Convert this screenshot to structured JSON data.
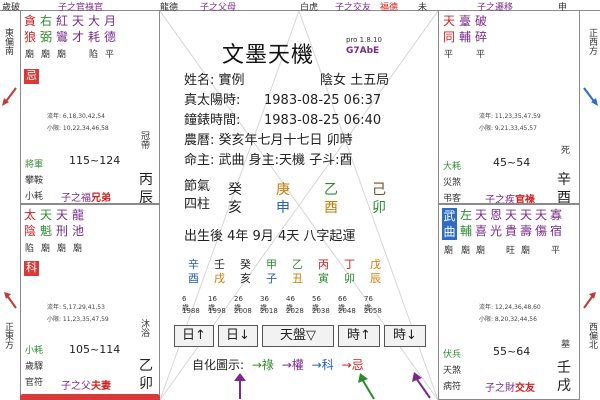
{
  "top_strip": {
    "left_a": "歲破",
    "left_b": "子之官祿官",
    "left_c": "龍德",
    "left_d": "子之父母",
    "left_e": "白虎",
    "left_f": "子之交友",
    "left_g": "福德",
    "left_h": "未",
    "right_a": "子之遷移",
    "right_b": "申"
  },
  "left_top": {
    "stars": [
      "貪",
      "右",
      "紅",
      "天",
      "大",
      "月"
    ],
    "stars2": [
      "狼",
      "弼",
      "鸞",
      "才",
      "耗",
      "德"
    ],
    "levels": [
      "廟",
      "廟",
      "廟",
      "陷",
      "平"
    ],
    "badge": "忌",
    "year_line1": "流年: 6,18,30,42,54",
    "year_line2": "小限: 10,22,34,46,58",
    "status": "冠帶",
    "god1": "將軍",
    "god2": "攀鞍",
    "god3": "小耗",
    "range": "115~124",
    "palace": "子之福",
    "palace_hl": "兄弟",
    "branch1": "丙",
    "branch2": "辰"
  },
  "left_mid": {
    "stars": [
      "太",
      "天",
      "天",
      "龍"
    ],
    "stars2": [
      "陰",
      "魁",
      "刑",
      "池"
    ],
    "levels": [
      "陷",
      "廟",
      "廟",
      "廟"
    ],
    "badge": "科",
    "year_line1": "流年: 5,17,29,41,53",
    "year_line2": "小限: 11,23,35,47,59",
    "status": "沐浴",
    "god1": "小耗",
    "god2": "歲驛",
    "god3": "官符",
    "range": "105~114",
    "palace": "子之父",
    "palace_hl": "夫妻",
    "branch1": "乙",
    "branch2": "卯"
  },
  "right_top": {
    "stars": [
      "天",
      "臺",
      "破"
    ],
    "stars2": [
      "同",
      "輔",
      "碎"
    ],
    "levels": [
      "平",
      "平"
    ],
    "year_line1": "流年: 11,23,35,47,59",
    "year_line2": "小限: 9,21,33,45,57",
    "status": "死",
    "god1": "大耗",
    "god2": "災煞",
    "god3": "弔客",
    "range": "45~54",
    "palace": "子之疾",
    "palace_hl": "官祿",
    "branch1": "辛",
    "branch2": "酉"
  },
  "right_mid": {
    "stars_blue_box": [
      "武",
      "曲"
    ],
    "stars": [
      "左",
      "天",
      "恩",
      "天",
      "天",
      "天",
      "寡"
    ],
    "stars2": [
      "輔",
      "喜",
      "光",
      "貴",
      "壽",
      "傷",
      "宿"
    ],
    "levels": [
      "廟",
      "廟",
      "廟",
      "旺",
      "廟",
      "平"
    ],
    "year_line1": "流年: 12,24,36,48,60",
    "year_line2": "小限: 8,20,32,44,56",
    "status": "墓",
    "god1": "伏兵",
    "god2": "天煞",
    "god3": "病符",
    "range": "55~64",
    "palace": "子之財",
    "palace_hl": "交友",
    "branch1": "壬",
    "branch2": "戌"
  },
  "side_labels": {
    "left_top": "東偏南",
    "left_bottom": "正東方",
    "right_top": "正西方",
    "right_bottom": "西偏北"
  },
  "center": {
    "title": "文墨天機",
    "version": "pro 1.8.10",
    "code": "G7AbE",
    "name_label": "姓名: 實例",
    "gender": "陰女 土五局",
    "solar_label": "真太陽時:",
    "solar_value": "1983-08-25 06:37",
    "clock_label": "鐘錶時間:",
    "clock_value": "1983-08-25 06:40",
    "lunar": "農曆: 癸亥年七月十七日 卯時",
    "master": "命主: 武曲 身主:天機 子斗:酉",
    "pillar_label1": "節氣",
    "pillar_label2": "四柱",
    "pillar_top": [
      "癸",
      "庚",
      "乙",
      "己"
    ],
    "pillar_bottom": [
      "亥",
      "申",
      "酉",
      "卯"
    ],
    "luck_start": "出生後 4年 9月 4天 八字起運",
    "luck_top": [
      "辛",
      "壬",
      "癸",
      "甲",
      "乙",
      "丙",
      "丁",
      "戊"
    ],
    "luck_top2": [
      "酉",
      "戌",
      "亥",
      "子",
      "丑",
      "寅",
      "卯",
      "辰"
    ],
    "luck_top_left": [
      "辛",
      "酉"
    ],
    "luck_ages": [
      "6歲",
      "16歲",
      "26歲",
      "36歲",
      "46歲",
      "56歲",
      "66歲",
      "76歲"
    ],
    "luck_years": [
      "1988",
      "1998",
      "2008",
      "2018",
      "2028",
      "2038",
      "2048",
      "2058"
    ],
    "buttons": [
      "日↑",
      "日↓",
      "天盤▽",
      "時↑",
      "時↓"
    ],
    "legend_label": "自化圖示:",
    "legend_items": [
      "→祿",
      "→權",
      "→科",
      "→忌"
    ]
  },
  "colors": {
    "red": "#cc2222",
    "purple": "#7a2a8a",
    "green": "#2f8a2f",
    "blue": "#1f5fbf",
    "orange": "#d07a00",
    "teal": "#1a8a8a",
    "badge_red": "#d83a3a",
    "blue_box": "#2d6cc7"
  }
}
